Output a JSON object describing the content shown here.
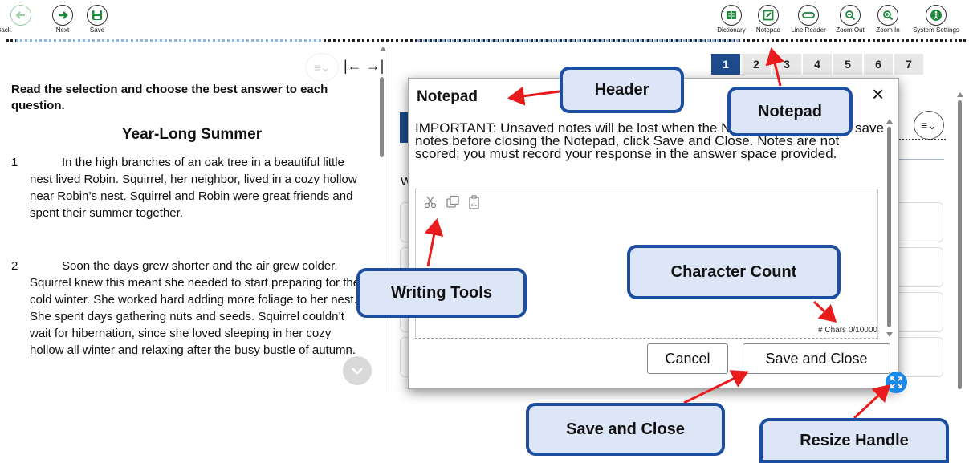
{
  "toolbar": {
    "left": [
      {
        "label": "Back",
        "icon": "arrow-left-icon"
      },
      {
        "label": "Next",
        "icon": "arrow-right-icon"
      },
      {
        "label": "Save",
        "icon": "floppy-disk-icon"
      }
    ],
    "right": [
      {
        "label": "Dictionary",
        "icon": "book-icon"
      },
      {
        "label": "Notepad",
        "icon": "notepad-icon"
      },
      {
        "label": "Line Reader",
        "icon": "line-reader-icon"
      },
      {
        "label": "Zoom Out",
        "icon": "zoom-out-icon"
      },
      {
        "label": "Zoom In",
        "icon": "zoom-in-icon"
      },
      {
        "label": "System Settings",
        "icon": "accessibility-icon"
      }
    ],
    "accent_color": "#1a8a3a"
  },
  "passage": {
    "instructions": "Read the selection and choose the best answer to each question.",
    "title": "Year-Long Summer",
    "paragraphs": [
      {
        "num": "1",
        "text": "In the high branches of an oak tree in a beautiful little nest lived Robin. Squirrel, her neighbor, lived in a cozy hollow near Robin’s nest. Squirrel and Robin were great friends and spent their summer together."
      },
      {
        "num": "2",
        "text": "Soon the days grew shorter and the air grew colder. Squirrel knew this meant she needed to start preparing for the cold winter. She worked hard adding more foliage to her nest. She spent days gathering nuts and seeds. Squirrel couldn’t wait for hibernation, since she loved sleeping in her cozy hollow all winter and relaxing after the busy bustle of autumn."
      }
    ]
  },
  "question_tabs": [
    "1",
    "2",
    "3",
    "4",
    "5",
    "6",
    "7"
  ],
  "active_tab": "1",
  "question_fragment": "W",
  "notepad": {
    "title": "Notepad",
    "close_symbol": "×",
    "notice": "IMPORTANT: Unsaved notes will be lost when the Notepad is closed. To save notes before closing the Notepad, click Save and Close. Notes are not scored; you must record your response in the answer space provided.",
    "tools": [
      "cut-icon",
      "copy-icon",
      "paste-icon"
    ],
    "char_count": "# Chars 0/10000",
    "cancel_label": "Cancel",
    "save_close_label": "Save and Close"
  },
  "callouts": {
    "header": "Header",
    "notepad": "Notepad",
    "writing_tools": "Writing Tools",
    "character_count": "Character Count",
    "save_and_close": "Save and Close",
    "resize_handle": "Resize Handle"
  },
  "colors": {
    "callout_fill": "#dde6f7",
    "callout_border": "#1d4fa0",
    "arrow": "#e81c1c",
    "tab_active": "#1d4c8c",
    "resize_handle": "#1e88e5"
  }
}
